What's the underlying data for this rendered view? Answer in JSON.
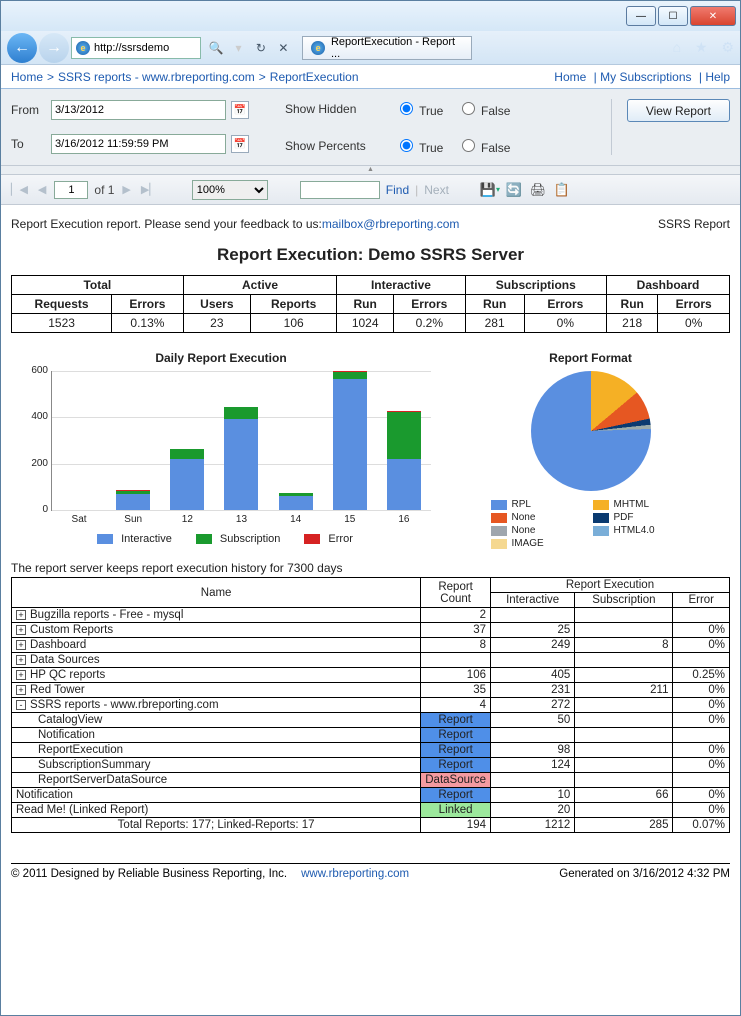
{
  "window": {
    "url": "http://ssrsdemo",
    "tab_title": "ReportExecution - Report ..."
  },
  "breadcrumb": {
    "items": [
      "Home",
      "SSRS reports - www.rbreporting.com",
      "ReportExecution"
    ],
    "right_links": [
      "Home",
      "My Subscriptions",
      "Help"
    ]
  },
  "params": {
    "from_label": "From",
    "from_value": "3/13/2012",
    "to_label": "To",
    "to_value": "3/16/2012 11:59:59 PM",
    "show_hidden_label": "Show Hidden",
    "show_percents_label": "Show Percents",
    "true_label": "True",
    "false_label": "False",
    "view_report": "View Report"
  },
  "toolbar": {
    "page_value": "1",
    "page_total": "of 1",
    "zoom": "100%",
    "find": "Find",
    "next": "Next"
  },
  "report": {
    "feedback": "Report Execution report. Please send your feedback to us: ",
    "feedback_email": "mailbox@rbreporting.com",
    "right_label": "SSRS Report",
    "title": "Report Execution: Demo SSRS Server",
    "summary_headers": [
      "Total",
      "Active",
      "Interactive",
      "Subscriptions",
      "Dashboard"
    ],
    "summary_sub": [
      "Requests",
      "Errors",
      "Users",
      "Reports",
      "Run",
      "Errors",
      "Run",
      "Errors",
      "Run",
      "Errors"
    ],
    "summary_vals": [
      "1523",
      "0.13%",
      "23",
      "106",
      "1024",
      "0.2%",
      "281",
      "0%",
      "218",
      "0%"
    ],
    "history_note": "The report server keeps report execution history for 7300 days"
  },
  "chart_data": [
    {
      "type": "bar",
      "title": "Daily Report Execution",
      "categories": [
        "Sat",
        "Sun",
        "12",
        "13",
        "14",
        "15",
        "16"
      ],
      "series": [
        {
          "name": "Interactive",
          "color": "#5a8fe0",
          "values": [
            0,
            70,
            220,
            390,
            60,
            560,
            220
          ]
        },
        {
          "name": "Subscription",
          "color": "#1a9a2e",
          "values": [
            0,
            12,
            40,
            50,
            15,
            30,
            200
          ]
        },
        {
          "name": "Error",
          "color": "#d62222",
          "values": [
            0,
            3,
            2,
            2,
            0,
            5,
            3
          ]
        }
      ],
      "ylim": [
        0,
        600
      ],
      "yticks": [
        0,
        200,
        400,
        600
      ]
    },
    {
      "type": "pie",
      "title": "Report Format",
      "slices": [
        {
          "label": "RPL",
          "color": "#5a8fe0",
          "value": 76
        },
        {
          "label": "MHTML",
          "color": "#f5b025",
          "value": 14
        },
        {
          "label": "None",
          "color": "#e65722",
          "value": 7
        },
        {
          "label": "PDF",
          "color": "#0a3a70",
          "value": 2
        },
        {
          "label": "None",
          "color": "#9fa6ad",
          "value": 0.5
        },
        {
          "label": "HTML4.0",
          "color": "#7aaed8",
          "value": 0.3
        },
        {
          "label": "IMAGE",
          "color": "#f5d890",
          "value": 0.2
        }
      ]
    }
  ],
  "detail": {
    "headers": {
      "name": "Name",
      "count": "Report Count",
      "exec": "Report Execution",
      "inter": "Interactive",
      "sub": "Subscription",
      "err": "Error"
    },
    "rows": [
      {
        "exp": "+",
        "name": "Bugzilla reports - Free - mysql",
        "count": "2",
        "inter": "",
        "sub": "",
        "err": ""
      },
      {
        "exp": "+",
        "name": "Custom Reports",
        "count": "37",
        "inter": "25",
        "sub": "",
        "err": "0%"
      },
      {
        "exp": "+",
        "name": "Dashboard",
        "count": "8",
        "inter": "249",
        "sub": "8",
        "err": "0%"
      },
      {
        "exp": "+",
        "name": "Data Sources",
        "count": "",
        "inter": "",
        "sub": "",
        "err": ""
      },
      {
        "exp": "+",
        "name": "HP QC reports",
        "count": "106",
        "inter": "405",
        "sub": "",
        "err": "0.25%"
      },
      {
        "exp": "+",
        "name": "Red Tower",
        "count": "35",
        "inter": "231",
        "sub": "211",
        "err": "0%"
      },
      {
        "exp": "-",
        "name": "SSRS reports - www.rbreporting.com",
        "count": "4",
        "inter": "272",
        "sub": "",
        "err": "0%"
      },
      {
        "indent": true,
        "name": "CatalogView",
        "tag": "Report",
        "inter": "50",
        "sub": "",
        "err": "0%"
      },
      {
        "indent": true,
        "name": "Notification",
        "tag": "Report",
        "inter": "",
        "sub": "",
        "err": ""
      },
      {
        "indent": true,
        "name": "ReportExecution",
        "tag": "Report",
        "inter": "98",
        "sub": "",
        "err": "0%"
      },
      {
        "indent": true,
        "name": "SubscriptionSummary",
        "tag": "Report",
        "inter": "124",
        "sub": "",
        "err": "0%"
      },
      {
        "indent": true,
        "name": "ReportServerDataSource",
        "tag": "DataSource",
        "inter": "",
        "sub": "",
        "err": ""
      },
      {
        "exp": "",
        "name": "Notification",
        "tag": "Report",
        "inter": "10",
        "sub": "66",
        "err": "0%"
      },
      {
        "exp": "",
        "name": "Read Me! (Linked Report)",
        "tag": "Linked",
        "inter": "20",
        "sub": "",
        "err": "0%"
      }
    ],
    "total_label": "Total Reports: 177; Linked-Reports: 17",
    "total_count": "194",
    "total_inter": "1212",
    "total_sub": "285",
    "total_err": "0.07%"
  },
  "footer": {
    "copyright": "© 2011 Designed by Reliable Business Reporting, Inc.",
    "link": "www.rbreporting.com",
    "generated": "Generated on 3/16/2012 4:32 PM"
  }
}
